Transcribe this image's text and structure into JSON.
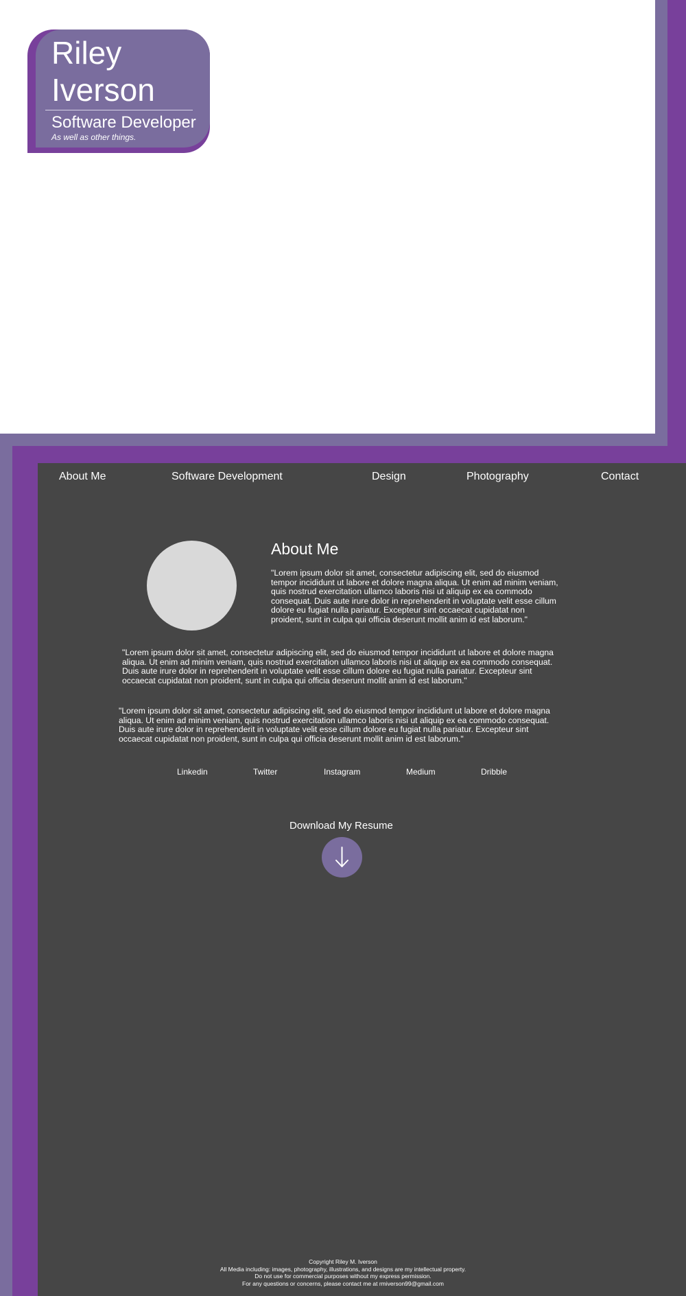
{
  "header": {
    "name_line1": "Riley",
    "name_line2": "Iverson",
    "title": "Software Developer",
    "subtitle": "As well as other things."
  },
  "nav": {
    "items": [
      "About Me",
      "Software Development",
      "Design",
      "Photography",
      "Contact"
    ]
  },
  "about": {
    "heading": "About Me",
    "paragraph1": "\"Lorem ipsum dolor sit amet, consectetur adipiscing elit, sed do eiusmod tempor incididunt ut labore et dolore magna aliqua. Ut enim ad minim veniam, quis nostrud exercitation ullamco laboris nisi ut aliquip ex ea commodo consequat. Duis aute irure dolor in reprehenderit in voluptate velit esse cillum dolore eu fugiat nulla pariatur. Excepteur sint occaecat cupidatat non proident, sunt in culpa qui officia deserunt mollit anim id est laborum.\"",
    "paragraph2": "\"Lorem ipsum dolor sit amet, consectetur adipiscing elit, sed do eiusmod tempor incididunt ut labore et dolore magna aliqua. Ut enim ad minim veniam, quis nostrud exercitation ullamco laboris nisi ut aliquip ex ea commodo consequat. Duis aute irure dolor in reprehenderit in voluptate velit esse cillum dolore eu fugiat nulla pariatur. Excepteur sint occaecat cupidatat non proident, sunt in culpa qui officia deserunt mollit anim id est laborum.\"",
    "paragraph3": "\"Lorem ipsum dolor sit amet, consectetur adipiscing elit, sed do eiusmod tempor incididunt ut labore et dolore magna aliqua. Ut enim ad minim veniam, quis nostrud exercitation ullamco laboris nisi ut aliquip ex ea commodo consequat. Duis aute irure dolor in reprehenderit in voluptate velit esse cillum dolore eu fugiat nulla pariatur. Excepteur sint occaecat cupidatat non proident, sunt in culpa qui officia deserunt mollit anim id est laborum.\""
  },
  "socials": [
    "Linkedin",
    "Twitter",
    "Instagram",
    "Medium",
    "Dribble"
  ],
  "resume": {
    "label": "Download My Resume",
    "icon": "arrow-down-icon"
  },
  "footer": {
    "line1": "Copyright Riley M. Iverson",
    "line2": "All Media including: images, photography, illustrations, and designs are my intellectual property.",
    "line3": "Do not use for commercial purposes without my express permission.",
    "line4": "For any questions or concerns, please contact me at rmiverson99@gmail.com"
  },
  "colors": {
    "purple_light": "#7a6d9e",
    "purple_dark": "#78409b",
    "content_bg": "#464646",
    "avatar": "#d9d9d9"
  }
}
